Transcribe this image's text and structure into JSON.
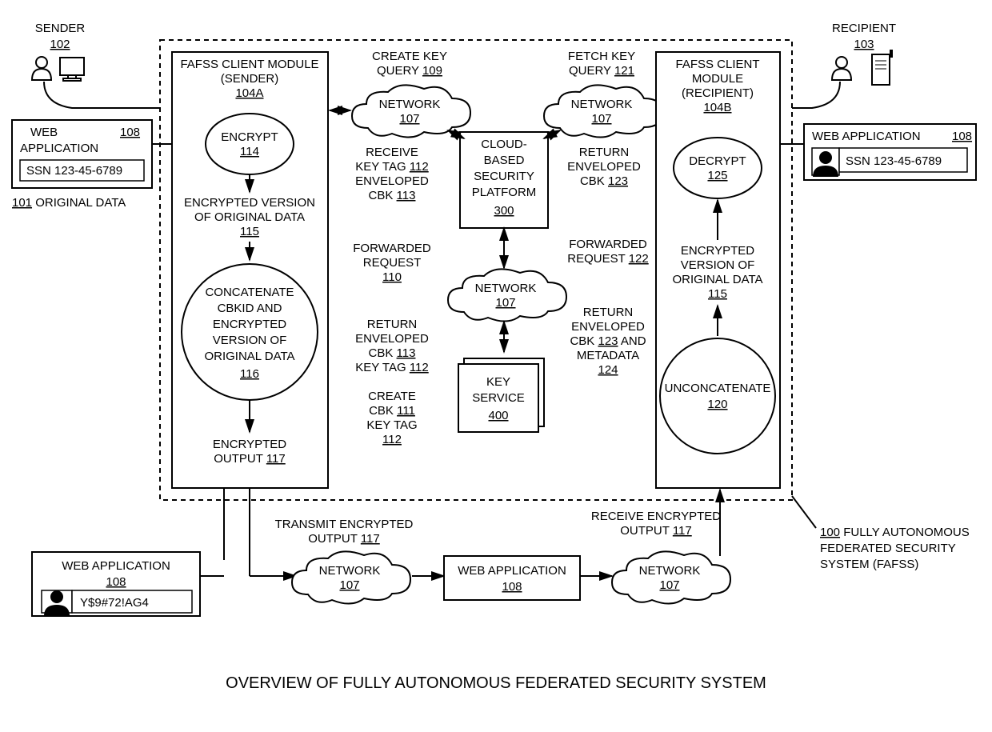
{
  "title": "OVERVIEW OF FULLY AUTONOMOUS FEDERATED SECURITY SYSTEM",
  "sender": {
    "label": "SENDER",
    "ref": "102"
  },
  "recipient": {
    "label": "RECIPIENT",
    "ref": "103"
  },
  "webapp_left": {
    "label": "WEB",
    "label2": "APPLICATION",
    "ref": "108",
    "ssn": "SSN 123-45-6789"
  },
  "webapp_right": {
    "label": "WEB APPLICATION",
    "ref": "108",
    "ssn": "SSN 123-45-6789"
  },
  "original_data": {
    "ref": "101",
    "label": "ORIGINAL DATA"
  },
  "outer": {
    "ref": "100",
    "label1": "FULLY AUTONOMOUS",
    "label2": "FEDERATED SECURITY",
    "label3": "SYSTEM (FAFSS)"
  },
  "sender_module": {
    "line1": "FAFSS CLIENT MODULE",
    "line2": "(SENDER)",
    "ref": "104A"
  },
  "recipient_module": {
    "line1": "FAFSS CLIENT",
    "line2": "MODULE",
    "line3": "(RECIPIENT)",
    "ref": "104B"
  },
  "encrypt": {
    "label": "ENCRYPT",
    "ref": "114"
  },
  "decrypt": {
    "label": "DECRYPT",
    "ref": "125"
  },
  "enc_version": {
    "line1": "ENCRYPTED VERSION",
    "line2": "OF ORIGINAL DATA",
    "ref": "115"
  },
  "enc_version_r": {
    "line1": "ENCRYPTED",
    "line2": "VERSION OF",
    "line3": "ORIGINAL DATA",
    "ref": "115"
  },
  "concat": {
    "line1": "CONCATENATE",
    "line2": "CBKID AND",
    "line3": "ENCRYPTED",
    "line4": "VERSION OF",
    "line5": "ORIGINAL DATA",
    "ref": "116"
  },
  "unconcat": {
    "label": "UNCONCATENATE",
    "ref": "120"
  },
  "enc_output": {
    "line1": "ENCRYPTED",
    "line2": "OUTPUT",
    "ref": "117"
  },
  "create_key": {
    "line1": "CREATE KEY",
    "line2": "QUERY",
    "ref": "109"
  },
  "fetch_key": {
    "line1": "FETCH KEY",
    "line2": "QUERY",
    "ref": "121"
  },
  "network": {
    "label": "NETWORK",
    "ref": "107"
  },
  "cloud_platform": {
    "line1": "CLOUD-",
    "line2": "BASED",
    "line3": "SECURITY",
    "line4": "PLATFORM",
    "ref": "300"
  },
  "key_service": {
    "line1": "KEY",
    "line2": "SERVICE",
    "ref": "400"
  },
  "receive_tag": {
    "line1": "RECEIVE",
    "line2": "KEY TAG",
    "ref2": "112",
    "line3": "ENVELOPED",
    "line4": "CBK",
    "ref4": "113"
  },
  "return_env": {
    "line1": "RETURN",
    "line2": "ENVELOPED",
    "line3": "CBK",
    "ref": "123"
  },
  "forwarded_left": {
    "line1": "FORWARDED",
    "line2": "REQUEST",
    "ref": "110"
  },
  "forwarded_right": {
    "line1": "FORWARDED",
    "line2": "REQUEST",
    "ref": "122"
  },
  "return_left": {
    "line1": "RETURN",
    "line2": "ENVELOPED",
    "line3": "CBK",
    "ref3": "113",
    "line4": "KEY TAG",
    "ref4": "112"
  },
  "return_right": {
    "line1": "RETURN",
    "line2": "ENVELOPED",
    "line3": "CBK",
    "ref3": "123",
    "line3b": "AND",
    "line4": "METADATA",
    "ref4": "124"
  },
  "create_cbk": {
    "line1": "CREATE",
    "line2": "CBK",
    "ref2": "111",
    "line3": "KEY TAG",
    "ref3": "112"
  },
  "transmit": {
    "line1": "TRANSMIT ENCRYPTED",
    "line2": "OUTPUT",
    "ref": "117"
  },
  "receive_out": {
    "line1": "RECEIVE ENCRYPTED",
    "line2": "OUTPUT",
    "ref": "117"
  },
  "webapp_bottom_left": {
    "label": "WEB APPLICATION",
    "ref": "108",
    "cipher": "Y$9#72!AG4"
  },
  "webapp_mid": {
    "label": "WEB APPLICATION",
    "ref": "108"
  }
}
